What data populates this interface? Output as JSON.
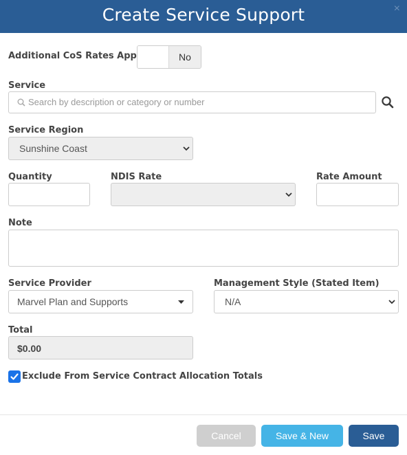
{
  "dialog": {
    "title": "Create Service Support",
    "close_icon": "close-icon"
  },
  "cos_rates": {
    "label": "Additional CoS Rates Apply",
    "state": "No"
  },
  "service": {
    "label": "Service",
    "placeholder": "Search by description or category or number"
  },
  "service_region": {
    "label": "Service Region",
    "value": "Sunshine Coast"
  },
  "quantity": {
    "label": "Quantity",
    "value": ""
  },
  "ndis_rate": {
    "label": "NDIS Rate",
    "value": ""
  },
  "rate_amount": {
    "label": "Rate Amount",
    "value": ""
  },
  "note": {
    "label": "Note",
    "value": ""
  },
  "service_provider": {
    "label": "Service Provider",
    "value": "Marvel Plan and Supports"
  },
  "management_style": {
    "label": "Management Style (Stated Item)",
    "value": "N/A"
  },
  "total": {
    "label": "Total",
    "value": "$0.00"
  },
  "exclude": {
    "label": "Exclude From Service Contract Allocation Totals",
    "checked": true
  },
  "buttons": {
    "cancel": "Cancel",
    "save_new": "Save & New",
    "save": "Save"
  },
  "colors": {
    "header": "#2a5d95",
    "save_new": "#45b4e6",
    "save": "#2a5d95",
    "cancel": "#cfcfcf",
    "checkbox": "#1a73e8"
  }
}
